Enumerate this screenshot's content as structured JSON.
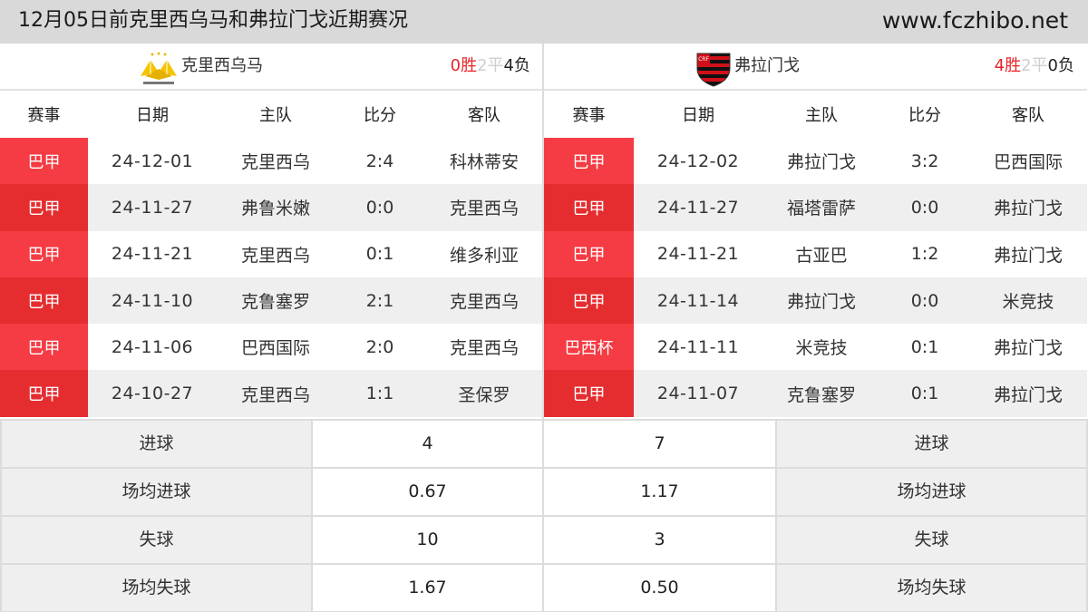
{
  "header": {
    "title": "12月05日前克里西乌马和弗拉门戈近期赛况",
    "site": "www.fczhibo.net"
  },
  "colors": {
    "accent_red": "#f53b43",
    "accent_red_dark": "#e52d30",
    "win": "#e8232a",
    "draw": "#cfcfcf",
    "loss": "#222222",
    "header_bg": "#d9d9d9"
  },
  "columns": [
    "赛事",
    "日期",
    "主队",
    "比分",
    "客队"
  ],
  "teams": [
    {
      "name": "克里西乌马",
      "logo": "criciuma-crest-icon",
      "record": {
        "win": "0胜",
        "draw": "2平",
        "loss": "4负"
      },
      "matches": [
        {
          "league": "巴甲",
          "date": "24-12-01",
          "home": "克里西乌",
          "score": "2:4",
          "away": "科林蒂安"
        },
        {
          "league": "巴甲",
          "date": "24-11-27",
          "home": "弗鲁米嫩",
          "score": "0:0",
          "away": "克里西乌"
        },
        {
          "league": "巴甲",
          "date": "24-11-21",
          "home": "克里西乌",
          "score": "0:1",
          "away": "维多利亚"
        },
        {
          "league": "巴甲",
          "date": "24-11-10",
          "home": "克鲁塞罗",
          "score": "2:1",
          "away": "克里西乌"
        },
        {
          "league": "巴甲",
          "date": "24-11-06",
          "home": "巴西国际",
          "score": "2:0",
          "away": "克里西乌"
        },
        {
          "league": "巴甲",
          "date": "24-10-27",
          "home": "克里西乌",
          "score": "1:1",
          "away": "圣保罗"
        }
      ]
    },
    {
      "name": "弗拉门戈",
      "logo": "flamengo-crest-icon",
      "record": {
        "win": "4胜",
        "draw": "2平",
        "loss": "0负"
      },
      "matches": [
        {
          "league": "巴甲",
          "date": "24-12-02",
          "home": "弗拉门戈",
          "score": "3:2",
          "away": "巴西国际"
        },
        {
          "league": "巴甲",
          "date": "24-11-27",
          "home": "福塔雷萨",
          "score": "0:0",
          "away": "弗拉门戈"
        },
        {
          "league": "巴甲",
          "date": "24-11-21",
          "home": "古亚巴",
          "score": "1:2",
          "away": "弗拉门戈"
        },
        {
          "league": "巴甲",
          "date": "24-11-14",
          "home": "弗拉门戈",
          "score": "0:0",
          "away": "米竞技"
        },
        {
          "league": "巴西杯",
          "date": "24-11-11",
          "home": "米竞技",
          "score": "0:1",
          "away": "弗拉门戈"
        },
        {
          "league": "巴甲",
          "date": "24-11-07",
          "home": "克鲁塞罗",
          "score": "0:1",
          "away": "弗拉门戈"
        }
      ]
    }
  ],
  "stats": [
    {
      "label": "进球",
      "left": "4",
      "right": "7"
    },
    {
      "label": "场均进球",
      "left": "0.67",
      "right": "1.17"
    },
    {
      "label": "失球",
      "left": "10",
      "right": "3"
    },
    {
      "label": "场均失球",
      "left": "1.67",
      "right": "0.50"
    }
  ]
}
